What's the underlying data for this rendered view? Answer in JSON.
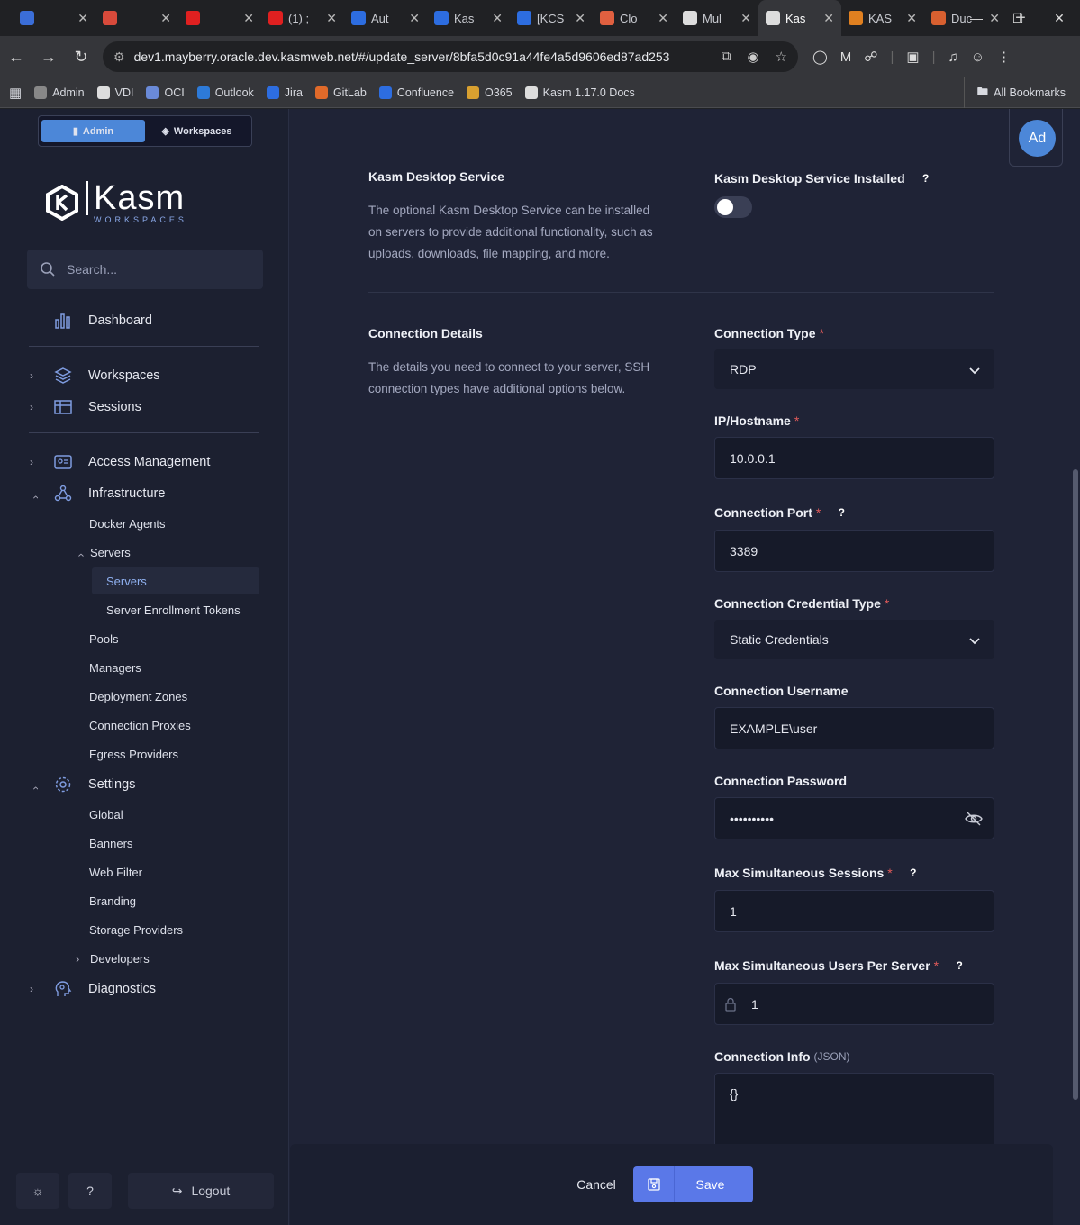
{
  "browser": {
    "tabs": [
      {
        "title": "",
        "color": "#3b6ed8"
      },
      {
        "title": "",
        "color": "#d84a3b"
      },
      {
        "title": "",
        "color": "#e02020"
      },
      {
        "title": "(1) ;",
        "color": "#e02020"
      },
      {
        "title": "Aut",
        "color": "#2d6de0"
      },
      {
        "title": "Kas",
        "color": "#2d6de0"
      },
      {
        "title": "[KCS",
        "color": "#2d6de0"
      },
      {
        "title": "Clo",
        "color": "#e06040"
      },
      {
        "title": "Mul",
        "color": "#dddddd"
      },
      {
        "title": "Kas",
        "color": "#dddddd",
        "active": true
      },
      {
        "title": "KAS",
        "color": "#e08020"
      },
      {
        "title": "Duc",
        "color": "#d86030"
      }
    ],
    "url": "dev1.mayberry.oracle.dev.kasmweb.net/#/update_server/8bfa5d0c91a44fe4a5d9606ed87ad253",
    "bookmarks": [
      {
        "label": "Admin",
        "color": "#888888"
      },
      {
        "label": "VDI",
        "color": "#dddddd"
      },
      {
        "label": "OCI",
        "color": "#6a8ad8"
      },
      {
        "label": "Outlook",
        "color": "#2d7ad8"
      },
      {
        "label": "Jira",
        "color": "#2d6de0"
      },
      {
        "label": "GitLab",
        "color": "#e06a2a"
      },
      {
        "label": "Confluence",
        "color": "#2d6de0"
      },
      {
        "label": "O365",
        "color": "#d8a030"
      },
      {
        "label": "Kasm 1.17.0 Docs",
        "color": "#dddddd"
      }
    ],
    "all_bookmarks": "All Bookmarks"
  },
  "sidebar": {
    "mode_admin": "Admin",
    "mode_workspaces": "Workspaces",
    "logo_text": "Kasm",
    "logo_sub": "WORKSPACES",
    "search_placeholder": "Search...",
    "dashboard": "Dashboard",
    "workspaces": "Workspaces",
    "sessions": "Sessions",
    "access_management": "Access Management",
    "infrastructure": "Infrastructure",
    "docker_agents": "Docker Agents",
    "servers_group": "Servers",
    "servers": "Servers",
    "server_enrollment_tokens": "Server Enrollment Tokens",
    "pools": "Pools",
    "managers": "Managers",
    "deployment_zones": "Deployment Zones",
    "connection_proxies": "Connection Proxies",
    "egress_providers": "Egress Providers",
    "settings": "Settings",
    "global": "Global",
    "banners": "Banners",
    "web_filter": "Web Filter",
    "branding": "Branding",
    "storage_providers": "Storage Providers",
    "developers": "Developers",
    "diagnostics": "Diagnostics",
    "logout": "Logout"
  },
  "header": {
    "avatar": "Ad"
  },
  "kds": {
    "title": "Kasm Desktop Service",
    "desc": "The optional Kasm Desktop Service can be installed on servers to provide additional functionality, such as uploads, downloads, file mapping, and more.",
    "installed_label": "Kasm Desktop Service Installed",
    "installed": false
  },
  "conn": {
    "title": "Connection Details",
    "desc": "The details you need to connect to your server, SSH connection types have additional options below."
  },
  "fields": {
    "conn_type_label": "Connection Type",
    "conn_type_value": "RDP",
    "ip_label": "IP/Hostname",
    "ip_value": "10.0.0.1",
    "port_label": "Connection Port",
    "port_value": "3389",
    "cred_type_label": "Connection Credential Type",
    "cred_type_value": "Static Credentials",
    "username_label": "Connection Username",
    "username_value": "EXAMPLE\\user",
    "password_label": "Connection Password",
    "password_value": "••••••••••",
    "max_sessions_label": "Max Simultaneous Sessions",
    "max_sessions_value": "1",
    "max_users_label": "Max Simultaneous Users Per Server",
    "max_users_value": "1",
    "conn_info_label": "Connection Info",
    "conn_info_sub": "(JSON)",
    "conn_info_value": "{}",
    "required_mark": "*",
    "help_mark": "?"
  },
  "footer": {
    "cancel": "Cancel",
    "save": "Save"
  }
}
